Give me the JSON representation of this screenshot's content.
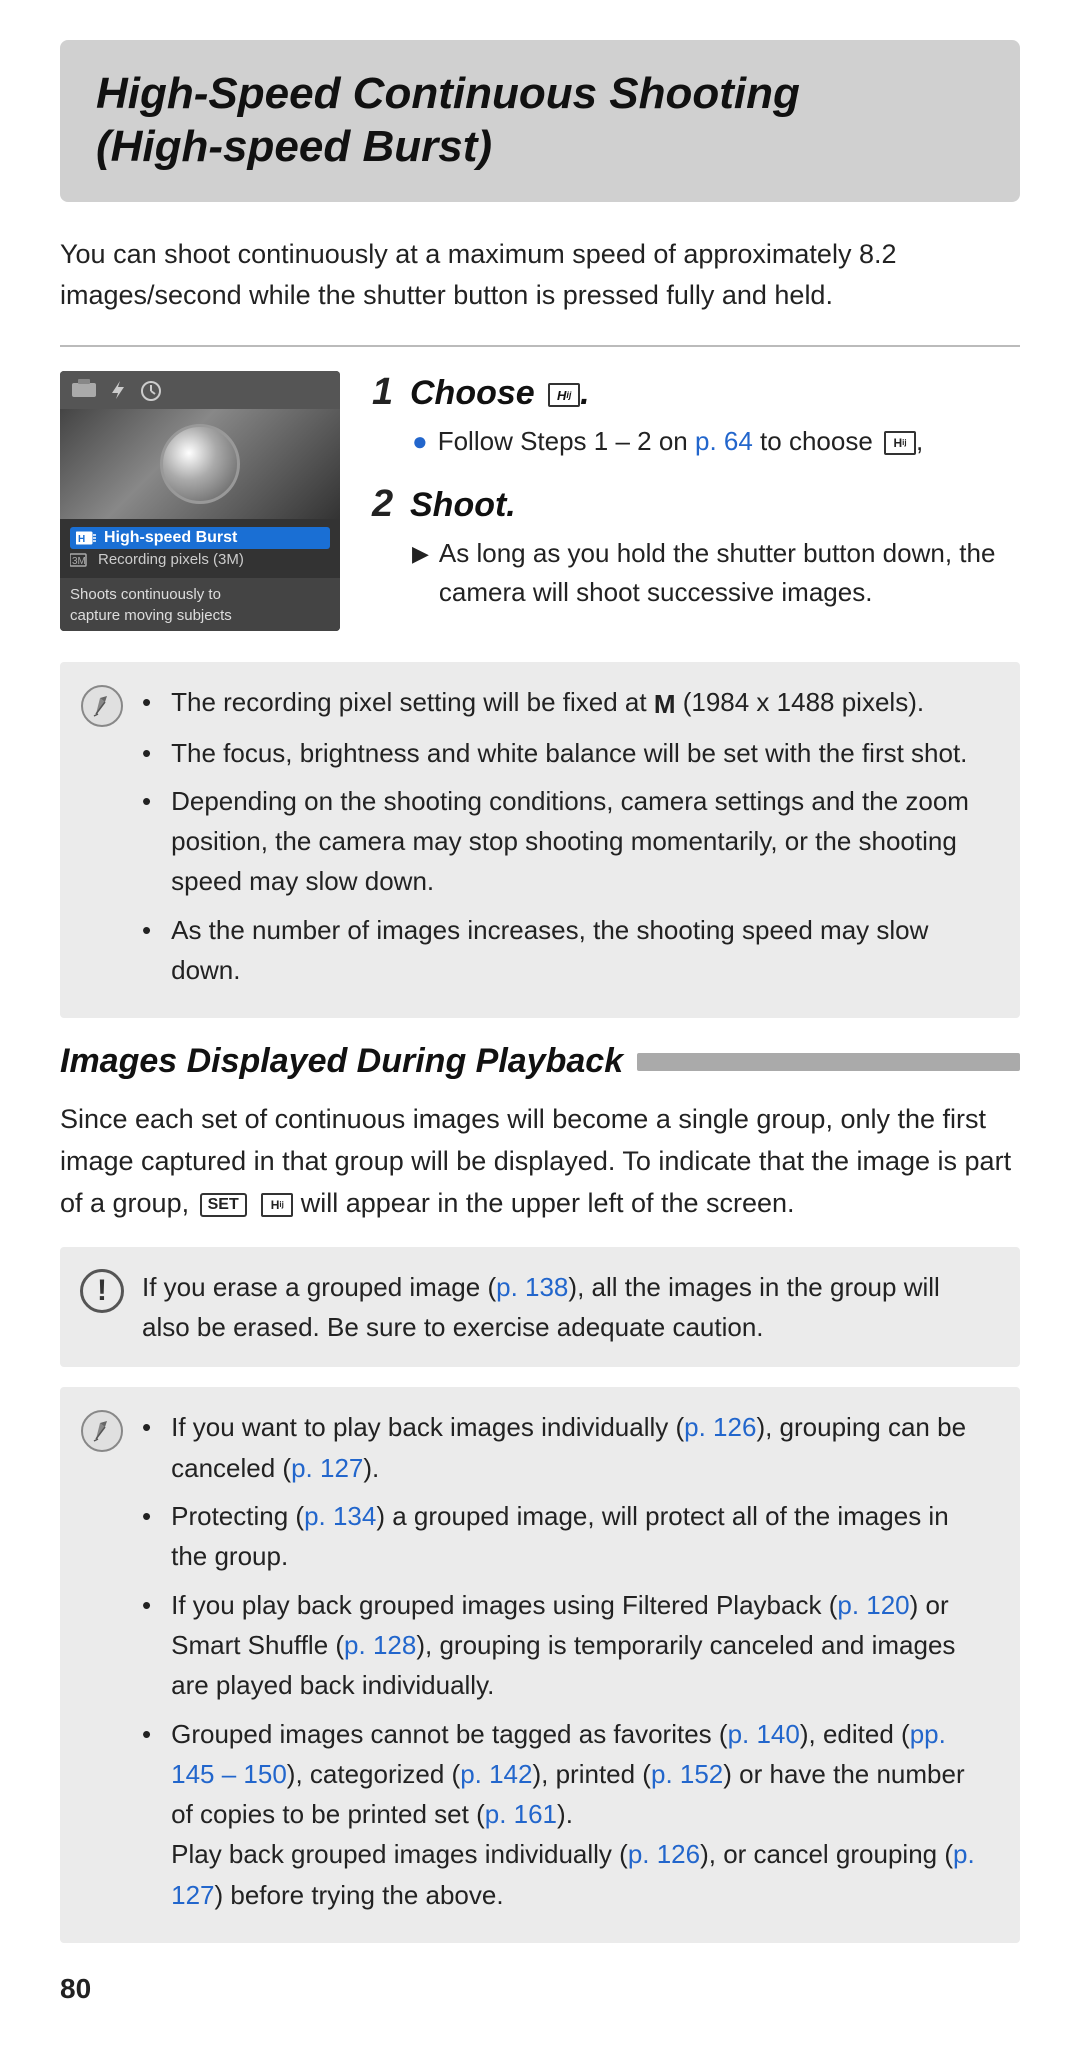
{
  "page": {
    "title_line1": "High-Speed Continuous Shooting",
    "title_line2": "(High-speed Burst)",
    "intro": "You can shoot continuously at a maximum speed of approximately 8.2 images/second while the shutter button is pressed fully and held.",
    "step1": {
      "number": "1",
      "title": "Choose",
      "icon_label": "H",
      "bullet": "Follow Steps 1 – 2 on",
      "bullet_link_text": "p. 64",
      "bullet_page": "p. 64",
      "bullet_suffix": "to choose"
    },
    "step2": {
      "number": "2",
      "title": "Shoot.",
      "bullet": "As long as you hold the shutter button down, the camera will shoot successive images."
    },
    "notes": [
      "The recording pixel setting will be fixed at M (1984 x 1488 pixels).",
      "The focus, brightness and white balance will be set with the first shot.",
      "Depending on the shooting conditions, camera settings and the zoom position, the camera may stop shooting momentarily, or the shooting speed may slow down.",
      "As the number of images increases, the shooting speed may slow down."
    ],
    "section2_title": "Images Displayed During Playback",
    "section2_body": "Since each set of continuous images will become a single group, only the first image captured in that group will be displayed. To indicate that the image is part of a group,",
    "section2_body_suffix": "will appear in the upper left of the screen.",
    "warning": {
      "text_pre": "If you erase a grouped image (",
      "link1": "p. 138",
      "text_mid": "), all the images in the group will also be erased. Be sure to exercise adequate caution."
    },
    "notes2": [
      {
        "text": "If you want to play back images individually (",
        "link": "p. 126",
        "suffix": "), grouping can be canceled (",
        "link2": "p. 127",
        "suffix2": ")."
      },
      {
        "text": "Protecting (",
        "link": "p. 134",
        "suffix": ") a grouped image, will protect all of the images in the group."
      },
      {
        "text": "If you play back grouped images using Filtered Playback (",
        "link": "p. 120",
        "suffix": ") or Smart Shuffle (",
        "link2": "p. 128",
        "suffix2": "), grouping is temporarily canceled and images are played back individually."
      },
      {
        "text": "Grouped images cannot be tagged as favorites (",
        "link": "p. 140",
        "suffix": "), edited (",
        "link2": "pp. 145 – 150",
        "suffix2": "), categorized (",
        "link3": "p. 142",
        "suffix3": "), printed (",
        "link4": "p. 152",
        "suffix4": ") or have the number of copies to be printed set (",
        "link5": "p. 161",
        "suffix5": "). Play back grouped images individually (",
        "link6": "p. 126",
        "suffix6": "), or cancel grouping (",
        "link7": "p. 127",
        "suffix7": ") before trying the above."
      }
    ],
    "page_number": "80",
    "camera_menu_items": [
      {
        "label": "High-speed Burst",
        "active": true
      },
      {
        "label": "Recording pixels (3M)",
        "active": false
      },
      {
        "label": "Shoots continuously to capture moving subjects",
        "active": false
      }
    ]
  }
}
